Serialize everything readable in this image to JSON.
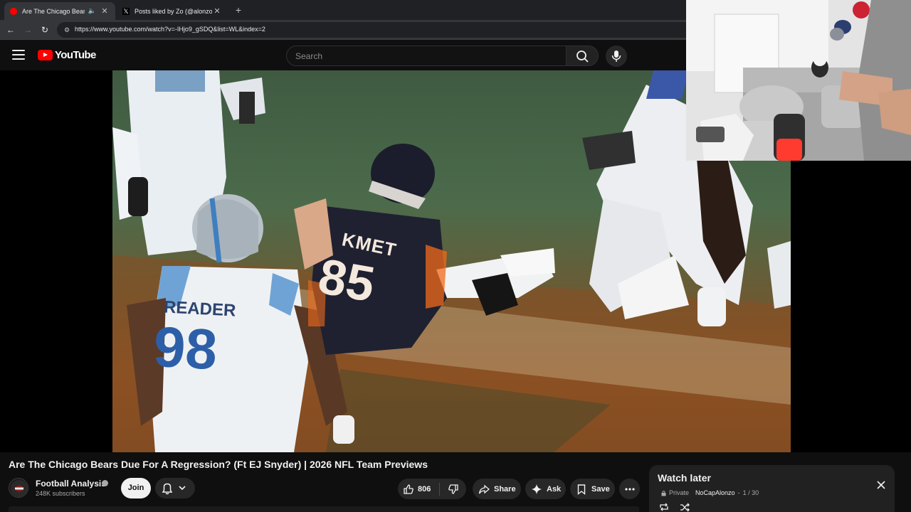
{
  "browser": {
    "tabs": [
      {
        "title": "Are The Chicago Bears Due For A Regression?",
        "active": true,
        "audio": true
      },
      {
        "title": "Posts liked by Zo (@alonzonemoto)",
        "active": false,
        "audio": false
      }
    ],
    "new_tab_label": "+",
    "url": "https://www.youtube.com/watch?v=-IHjo9_gSDQ&list=WL&index=2"
  },
  "youtube": {
    "logo_text": "YouTube",
    "search_placeholder": "Search"
  },
  "video": {
    "title": "Are The Chicago Bears Due For A Regression? (Ft EJ Snyder) | 2026 NFL Team Previews",
    "channel": "Football Analysis",
    "subscribers": "248K subscribers",
    "join_label": "Join",
    "likes": "806",
    "share_label": "Share",
    "ask_label": "Ask",
    "save_label": "Save",
    "jersey_texts": [
      "KMET",
      "85",
      "READER",
      "98"
    ]
  },
  "watch_later": {
    "title": "Watch later",
    "privacy": "Private",
    "owner": "NoCapAlonzo",
    "position": "1 / 30"
  },
  "colors": {
    "brand_red": "#ff0000",
    "page_bg": "#0f0f0f",
    "button_bg": "#272727"
  }
}
